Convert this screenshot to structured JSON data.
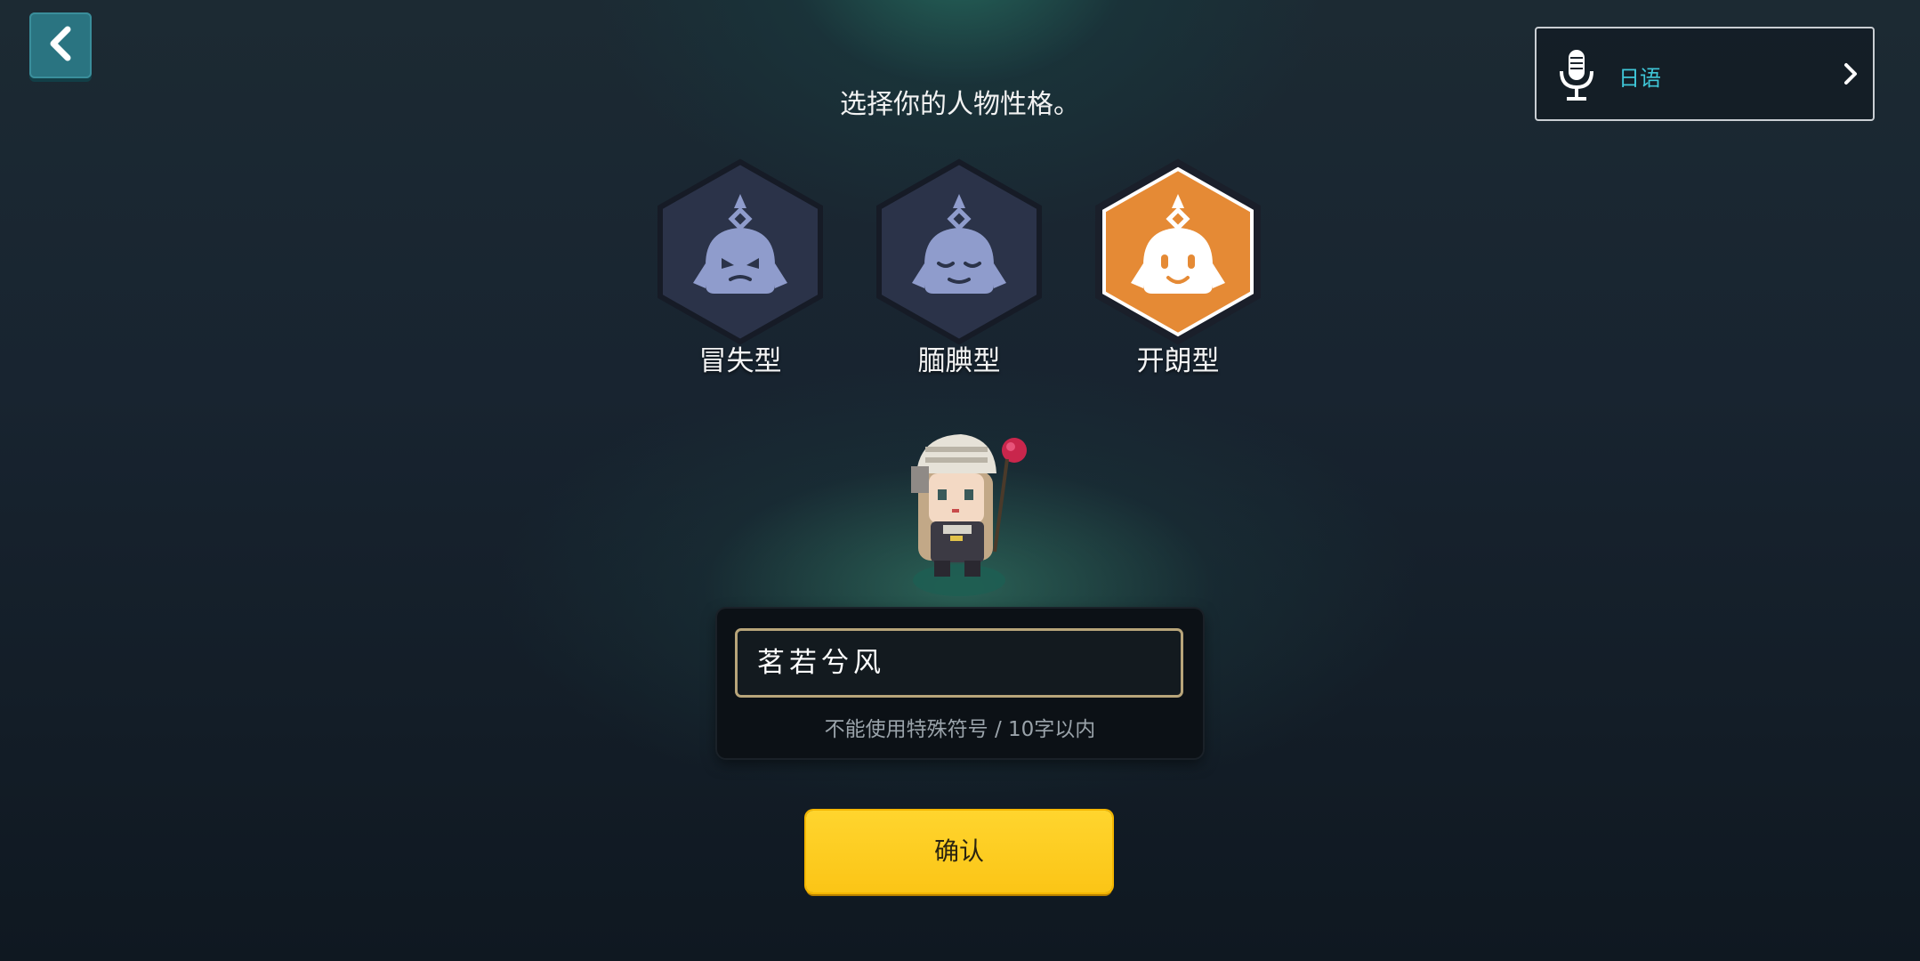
{
  "header": {
    "title": "选择你的人物性格。"
  },
  "voice": {
    "icon": "microphone-icon",
    "language": "日语",
    "accent": "#3fc7d8"
  },
  "personas": [
    {
      "label": "冒失型",
      "icon": "persona-brash-icon",
      "selected": false
    },
    {
      "label": "腼腆型",
      "icon": "persona-shy-icon",
      "selected": false
    },
    {
      "label": "开朗型",
      "icon": "persona-cheerful-icon",
      "selected": true
    }
  ],
  "name_input": {
    "value": "茗若兮风",
    "hint": "不能使用特殊符号 / 10字以内"
  },
  "confirm": {
    "label": "确认"
  },
  "colors": {
    "selected_hex": "#e58a35",
    "unselected_hex": "#2b3349",
    "confirm_button": "#fbc516"
  }
}
